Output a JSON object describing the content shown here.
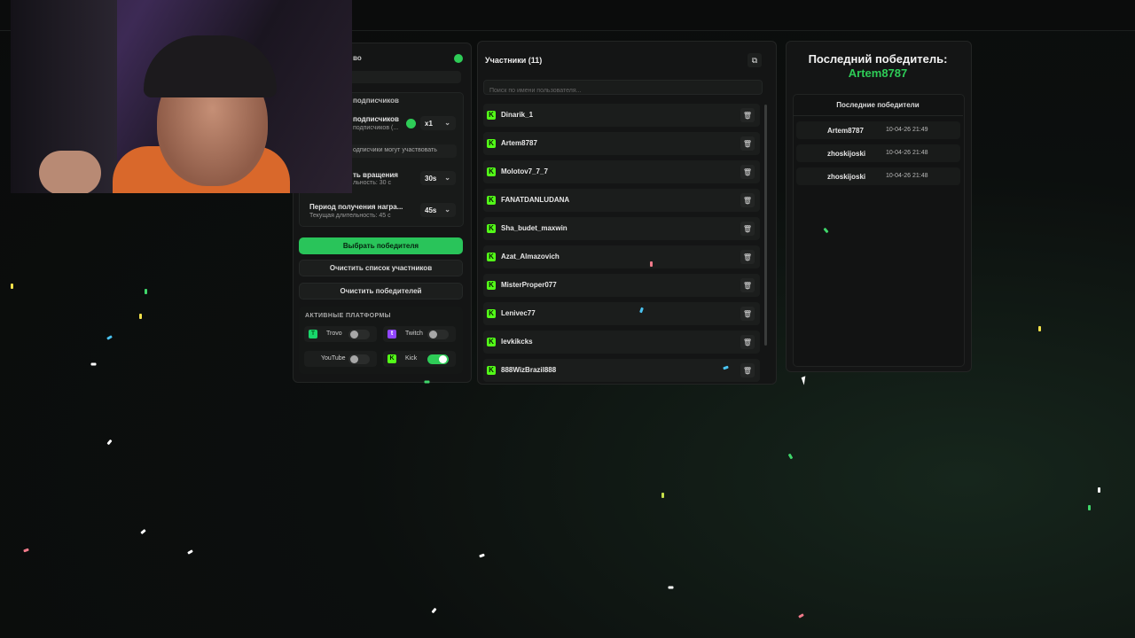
{
  "left_panel": {
    "header_partial": "во",
    "subscribers_section_title": "подписчиков",
    "subscribers_multiplier_label": "подписчиков",
    "subscribers_multiplier_sub": "подписчиков (...",
    "subscribers_multiplier_value": "x1",
    "subscribers_note": "одписчики могут участвовать",
    "spin_label": "ть вращения",
    "spin_sub": "льность: 30 с",
    "spin_value": "30s",
    "reward_label": "Период получения награ...",
    "reward_sub": "Текущая длительность: 45 с",
    "reward_value": "45s",
    "pick_winner": "Выбрать победителя",
    "clear_participants": "Очистить список участников",
    "clear_winners": "Очистить победителей",
    "platforms_title": "АКТИВНЫЕ ПЛАТФОРМЫ",
    "platforms": [
      {
        "name": "Trovo",
        "enabled": false,
        "color": "#19d66b"
      },
      {
        "name": "Twitch",
        "enabled": false,
        "color": "#9146ff"
      },
      {
        "name": "YouTube",
        "enabled": false,
        "color": "#ff0000"
      },
      {
        "name": "Kick",
        "enabled": true,
        "color": "#53fc18"
      }
    ]
  },
  "participants": {
    "title": "Участники (11)",
    "search_placeholder": "Поиск по имени пользователя...",
    "items": [
      "Dinarik_1",
      "Artem8787",
      "Molotov7_7_7",
      "FANATDANLUDANA",
      "Sha_budet_maxwin",
      "Azat_Almazovich",
      "MisterProper077",
      "Lenivec77",
      "levkikcks",
      "888WizBrazil888"
    ]
  },
  "winners": {
    "title": "Последний победитель:",
    "last_winner": "Artem8787",
    "recent_title": "Последние победители",
    "recent": [
      {
        "name": "Artem8787",
        "time": "10-04-26 21:49"
      },
      {
        "name": "zhoskijoski",
        "time": "10-04-26 21:48"
      },
      {
        "name": "zhoskijoski",
        "time": "10-04-26 21:48"
      }
    ]
  },
  "colors": {
    "accent": "#2ecc57",
    "kick": "#53fc18"
  }
}
